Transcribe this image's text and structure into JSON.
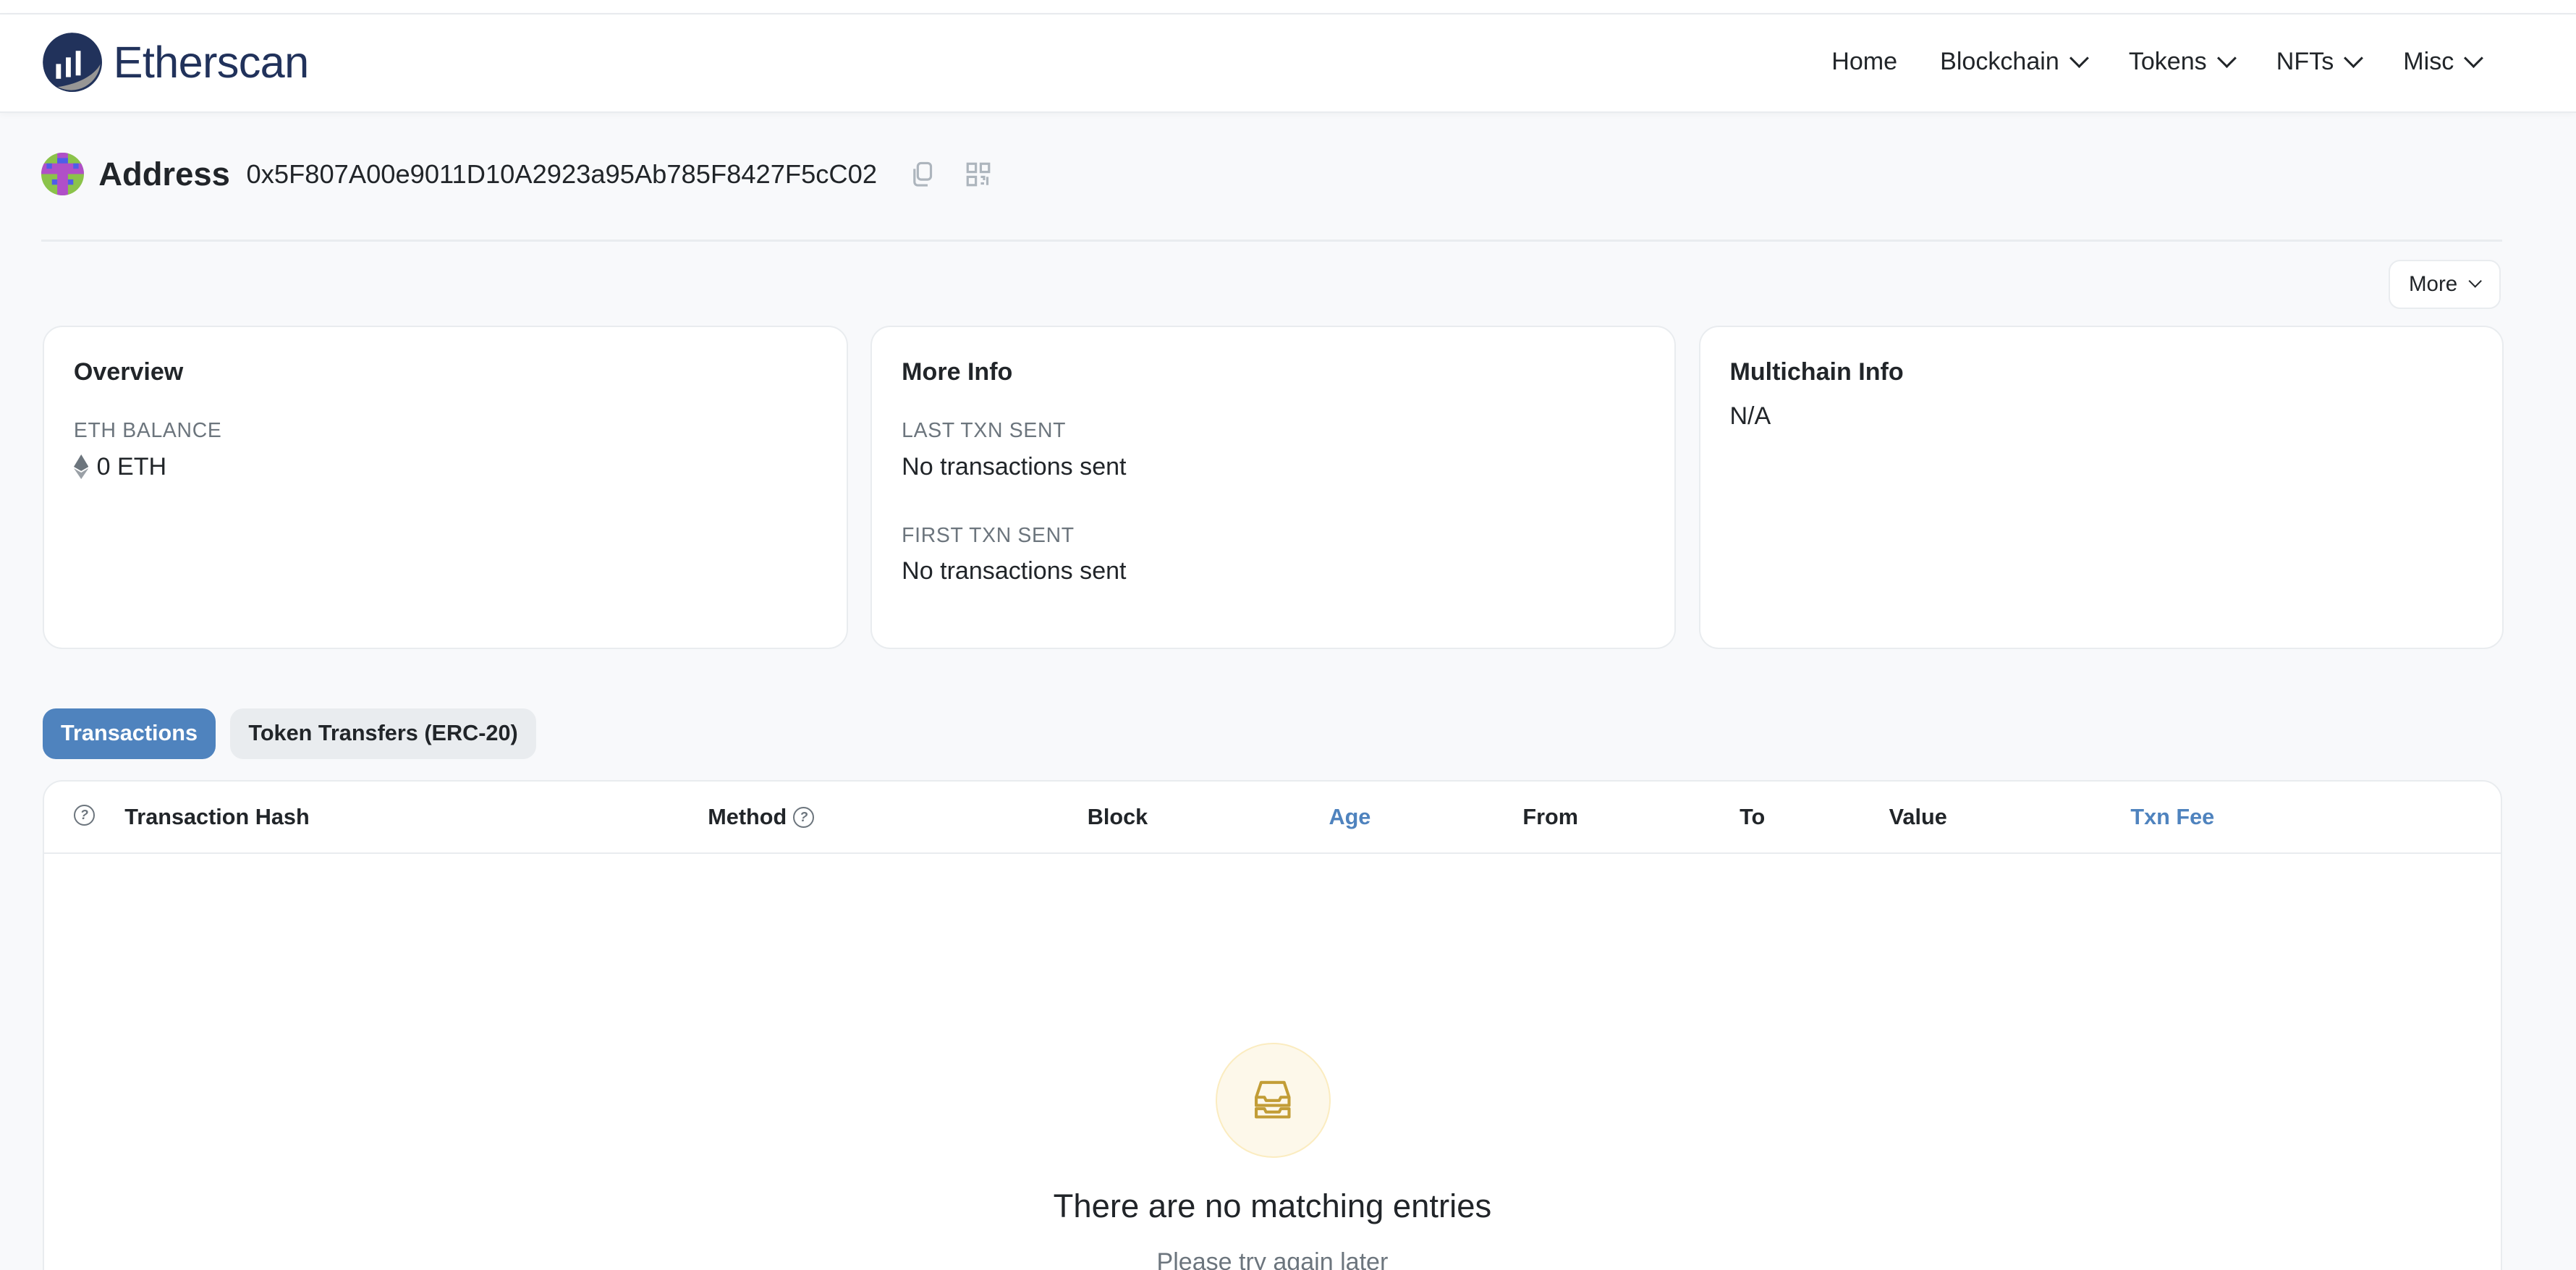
{
  "brand": {
    "name": "Etherscan"
  },
  "nav": {
    "items": [
      {
        "label": "Home",
        "dropdown": false
      },
      {
        "label": "Blockchain",
        "dropdown": true
      },
      {
        "label": "Tokens",
        "dropdown": true
      },
      {
        "label": "NFTs",
        "dropdown": true
      },
      {
        "label": "Misc",
        "dropdown": true
      }
    ]
  },
  "address": {
    "title": "Address",
    "hash": "0x5F807A00e9011D10A2923a95Ab785F8427F5cC02"
  },
  "more_button": "More",
  "cards": {
    "overview": {
      "title": "Overview",
      "balance_label": "ETH BALANCE",
      "balance_value": "0 ETH"
    },
    "more_info": {
      "title": "More Info",
      "last_label": "LAST TXN SENT",
      "last_value": "No transactions sent",
      "first_label": "FIRST TXN SENT",
      "first_value": "No transactions sent"
    },
    "multichain": {
      "title": "Multichain Info",
      "value": "N/A"
    }
  },
  "tabs": [
    {
      "label": "Transactions",
      "active": true
    },
    {
      "label": "Token Transfers (ERC-20)",
      "active": false
    }
  ],
  "table": {
    "columns": [
      "Transaction Hash",
      "Method",
      "Block",
      "Age",
      "From",
      "To",
      "Value",
      "Txn Fee"
    ]
  },
  "empty": {
    "title": "There are no matching entries",
    "subtitle": "Please try again later"
  },
  "colors": {
    "accent": "#4f83be",
    "brand": "#21325b",
    "empty_icon": "#c29d36"
  }
}
